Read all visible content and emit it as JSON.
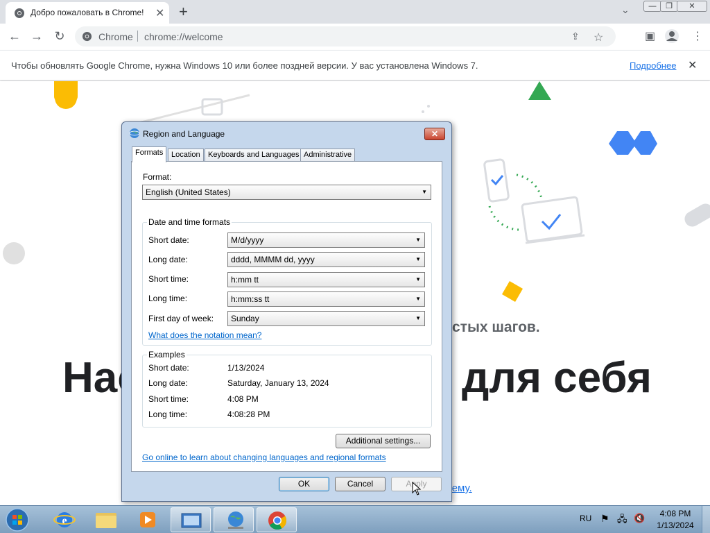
{
  "browser": {
    "tab_title": "Добро пожаловать в Chrome!",
    "omnibox_chip": "Chrome",
    "url": "chrome://welcome"
  },
  "infobar": {
    "message": "Чтобы обновлять Google Chrome, нужна Windows 10 или более поздней версии. У вас установлена Windows 7.",
    "link": "Подробнее"
  },
  "page": {
    "heading_left": "Нас",
    "heading_right": "для себя",
    "subtext": "стых шагов.",
    "bottom_link": "тему."
  },
  "dialog": {
    "title": "Region and Language",
    "tabs": [
      "Formats",
      "Location",
      "Keyboards and Languages",
      "Administrative"
    ],
    "active_tab": "Formats",
    "format_label": "Format:",
    "format_value": "English (United States)",
    "date_time_group": "Date and time formats",
    "fields": [
      {
        "label": "Short date:",
        "value": "M/d/yyyy"
      },
      {
        "label": "Long date:",
        "value": "dddd, MMMM dd, yyyy"
      },
      {
        "label": "Short time:",
        "value": "h:mm tt"
      },
      {
        "label": "Long time:",
        "value": "h:mm:ss tt"
      },
      {
        "label": "First day of week:",
        "value": "Sunday"
      }
    ],
    "notation_link": "What does the notation mean?",
    "examples_group": "Examples",
    "examples": [
      {
        "label": "Short date:",
        "value": "1/13/2024"
      },
      {
        "label": "Long date:",
        "value": "Saturday, January 13, 2024"
      },
      {
        "label": "Short time:",
        "value": "4:08 PM"
      },
      {
        "label": "Long time:",
        "value": "4:08:28 PM"
      }
    ],
    "additional_button": "Additional settings...",
    "online_link": "Go online to learn about changing languages and regional formats",
    "ok": "OK",
    "cancel": "Cancel",
    "apply": "Apply"
  },
  "taskbar": {
    "language": "RU",
    "time": "4:08 PM",
    "date": "1/13/2024"
  },
  "colors": {
    "accent": "#1a73e8",
    "dialog_frame": "#c5d7ec",
    "taskbar": "#8eaccb"
  }
}
